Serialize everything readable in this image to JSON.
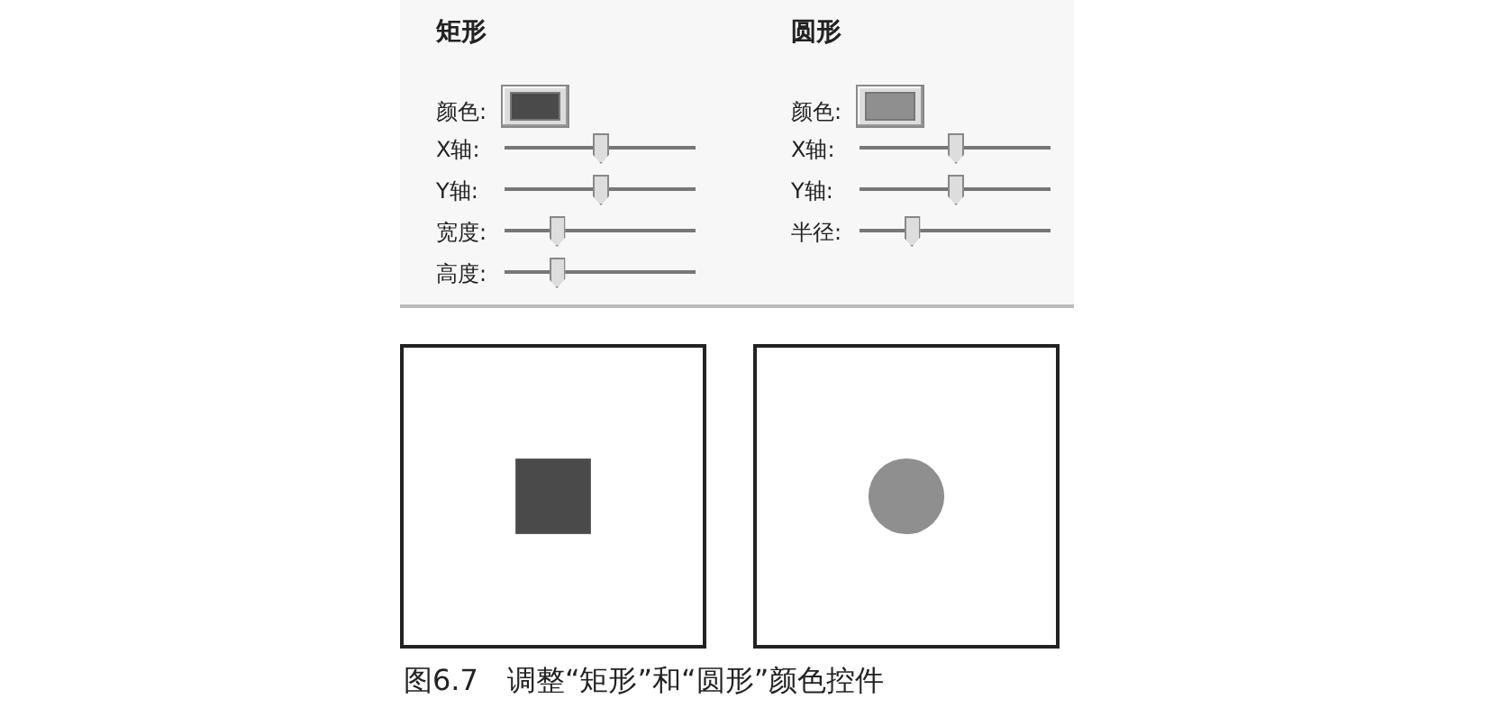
{
  "panels": [
    {
      "title": "矩形",
      "color_label": "颜色:",
      "color": "#4a4a4a",
      "kind": "rect",
      "sliders": [
        {
          "label": "X轴:",
          "level": 0.5
        },
        {
          "label": "Y轴:",
          "level": 0.5
        },
        {
          "label": "宽度:",
          "level": 0.27
        },
        {
          "label": "高度:",
          "level": 0.27
        }
      ]
    },
    {
      "title": "圆形",
      "color_label": "颜色:",
      "color": "#8f8f8f",
      "kind": "circle",
      "sliders": [
        {
          "label": "X轴:",
          "level": 0.5
        },
        {
          "label": "Y轴:",
          "level": 0.5
        },
        {
          "label": "半径:",
          "level": 0.27
        }
      ]
    }
  ],
  "caption": "图6.7　调整“矩形”和“圆形”颜色控件"
}
